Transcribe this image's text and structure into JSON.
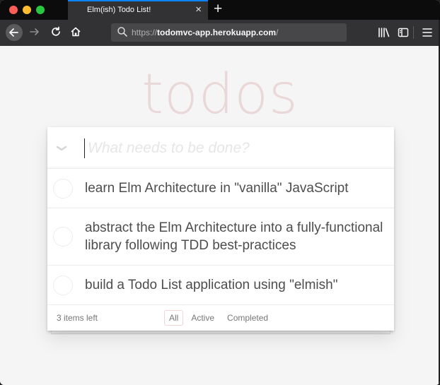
{
  "browser": {
    "tab_title": "Elm(ish) Todo List!",
    "tab_close": "×",
    "new_tab": "+",
    "url_scheme": "https://",
    "url_host": "todomvc-app.herokuapp.com",
    "url_rest": "/",
    "accent_color": "#0a84ff"
  },
  "app": {
    "title": "todos",
    "placeholder": "What needs to be done?",
    "todos": [
      {
        "text": "learn Elm Architecture in \"vanilla\" JavaScript"
      },
      {
        "text": "abstract the Elm Architecture into a fully-functional library following TDD best-practices"
      },
      {
        "text": "build a Todo List application using \"elmish\""
      }
    ],
    "items_left": "3 items left",
    "filters": {
      "all": "All",
      "active": "Active",
      "completed": "Completed"
    },
    "selected_filter": "All",
    "title_color": "#af2f2f"
  }
}
